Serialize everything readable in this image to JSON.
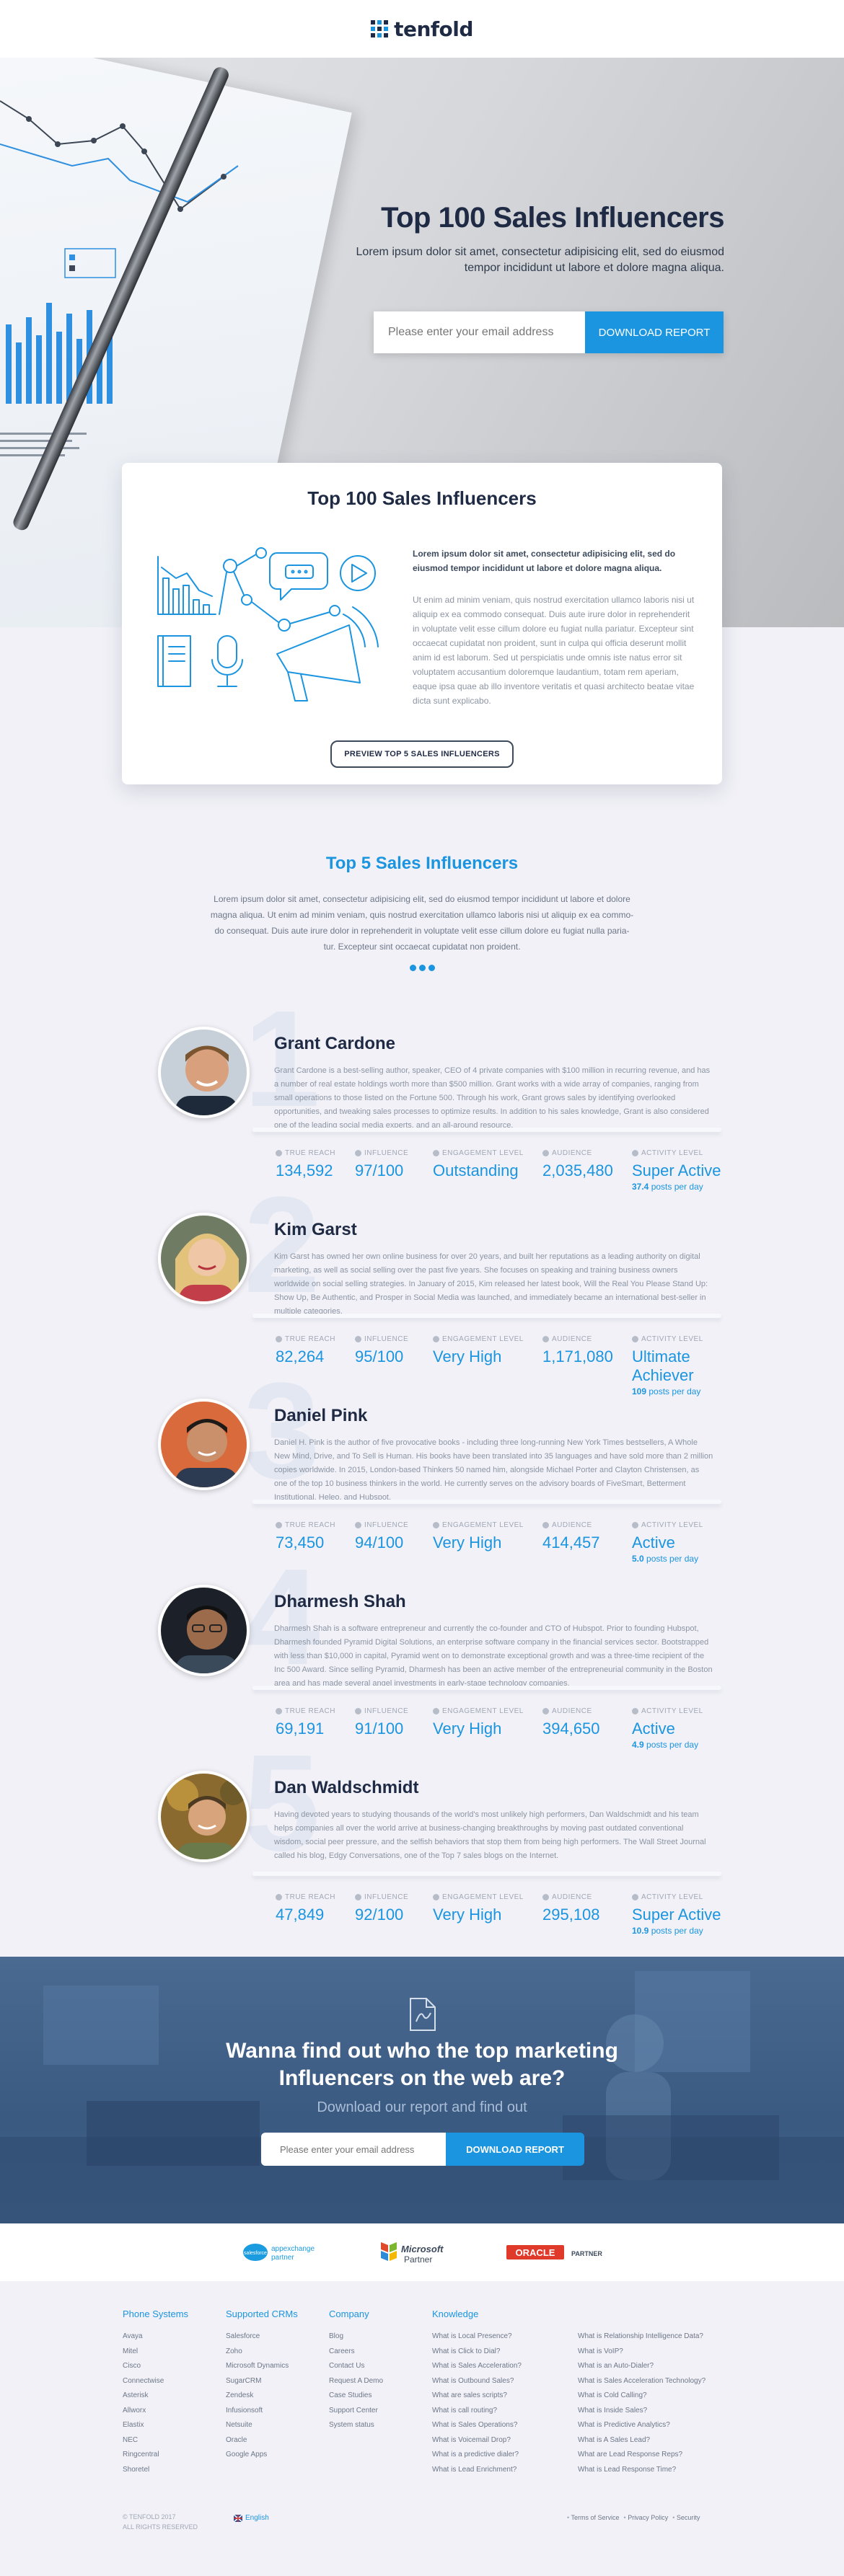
{
  "header": {
    "brand": "tenfold"
  },
  "hero": {
    "title": "Top 100 Sales Influencers",
    "subtitle": "Lorem ipsum dolor sit amet, consectetur adipisicing elit, sed do eiusmod tempor incididunt ut labore et dolore magna aliqua.",
    "email_placeholder": "Please enter your email address",
    "button": "DOWNLOAD REPORT"
  },
  "report_card": {
    "title": "Top 100 Sales Influencers",
    "lead": "Lorem ipsum dolor sit amet, consectetur adipisicing elit, sed do eiusmod tempor incididunt ut labore et dolore magna aliqua.",
    "body": "Ut enim ad minim veniam, quis nostrud exercitation ullamco laboris nisi ut aliquip ex ea commodo consequat. Duis aute irure dolor in reprehenderit in voluptate velit esse cillum dolore eu fugiat nulla pariatur. Excepteur sint occaecat cupidatat non proident, sunt in culpa qui officia deserunt mollit anim id est laborum. Sed ut perspiciatis unde omnis iste natus error sit voluptatem accusantium doloremque laudantium, totam rem aperiam, eaque ipsa quae ab illo inventore veritatis et quasi architecto beatae vitae dicta sunt explicabo.",
    "button": "PREVIEW TOP 5 SALES INFLUENCERS"
  },
  "top5": {
    "title": "Top 5 Sales Influencers",
    "intro": "Lorem ipsum dolor sit amet, consectetur adipisicing elit, sed do eiusmod tempor incididunt ut labore et dolore magna aliqua. Ut enim ad minim veniam, quis nostrud exercitation ullamco laboris nisi ut aliquip ex ea commo-do consequat. Duis aute irure dolor in reprehenderit in voluptate velit esse cillum dolore eu fugiat nulla paria-tur. Excepteur sint occaecat cupidatat non proident.",
    "labels": {
      "reach": "TRUE REACH",
      "influence": "INFLUENCE",
      "engagement": "ENGAGEMENT LEVEL",
      "audience": "AUDIENCE",
      "activity": "ACTIVITY LEVEL",
      "posts_per_day": "posts per day"
    },
    "people": [
      {
        "rank": "1",
        "name": "Grant Cardone",
        "bio": "Grant Cardone is a best-selling author, speaker, CEO of 4 private companies with $100 million in recurring revenue, and has a number of real estate holdings worth more than $500 million. Grant works with a wide array of companies, ranging from small operations to those listed on the Fortune 500. Through his work, Grant grows sales by identifying overlooked opportunities, and tweaking sales processes to optimize results. In addition to his sales knowledge, Grant is also considered one of the leading social media experts, and an all-around resource.",
        "reach": "134,592",
        "influence": "97/100",
        "engagement": "Outstanding",
        "audience": "2,035,480",
        "activity": "Super Active",
        "posts": "37.4"
      },
      {
        "rank": "2",
        "name": "Kim Garst",
        "bio": "Kim Garst has owned her own online business for over 20 years, and built her reputations as a leading authority on digital marketing, as well as social selling over the past five years. She focuses on speaking and training business owners worldwide on social selling strategies. In January of 2015, Kim released her latest book, Will the Real You Please Stand Up: Show Up, Be Authentic, and Prosper in Social Media was launched, and immediately became an international best-seller in multiple categories.",
        "reach": "82,264",
        "influence": "95/100",
        "engagement": "Very High",
        "audience": "1,171,080",
        "activity": "Ultimate Achiever",
        "posts": "109"
      },
      {
        "rank": "3",
        "name": "Daniel Pink",
        "bio": "Daniel H. Pink is the author of five provocative books - including three long-running New York Times bestsellers, A Whole New Mind, Drive, and To Sell is Human. His books have been translated into 35 languages and have sold more than 2 million copies worldwide. In 2015, London-based Thinkers 50 named him, alongside Michael Porter and Clayton Christensen, as one of the top 10 business thinkers in the world. He currently serves on the advisory boards of FiveSmart, Betterment Institutional, Heleo, and Hubspot.",
        "reach": "73,450",
        "influence": "94/100",
        "engagement": "Very High",
        "audience": "414,457",
        "activity": "Active",
        "posts": "5.0"
      },
      {
        "rank": "4",
        "name": "Dharmesh Shah",
        "bio": "Dharmesh Shah is a software entrepreneur and currently the co-founder and CTO of Hubspot. Prior to founding Hubspot, Dharmesh founded Pyramid Digital Solutions, an enterprise software company in the financial services sector. Bootstrapped with less than $10,000 in capital, Pyramid went on to demonstrate exceptional growth and was a three-time recipient of the Inc 500 Award. Since selling Pyramid, Dharmesh has been an active member of the entrepreneurial community in the Boston area and has made several angel investments in early-stage technology companies.",
        "reach": "69,191",
        "influence": "91/100",
        "engagement": "Very High",
        "audience": "394,650",
        "activity": "Active",
        "posts": "4.9"
      },
      {
        "rank": "5",
        "name": "Dan Waldschmidt",
        "bio": "Having devoted years to studying thousands of the world's most unlikely high performers, Dan Waldschmidt and his team helps companies all over the world arrive at business-changing breakthroughs by moving past outdated conventional wisdom, social peer pressure, and the selfish behaviors that stop them from being high performers. The Wall Street Journal called his blog, Edgy Conversations, one of the Top 7 sales blogs on the Internet.",
        "reach": "47,849",
        "influence": "92/100",
        "engagement": "Very High",
        "audience": "295,108",
        "activity": "Super Active",
        "posts": "10.9"
      }
    ]
  },
  "cta": {
    "title_line1": "Wanna find out who the top marketing",
    "title_line2": "Influencers on the web are?",
    "subtitle": "Download our report and find out",
    "email_placeholder": "Please enter your email address",
    "button": "DOWNLOAD REPORT"
  },
  "partners": {
    "salesforce_a": "salesforce",
    "salesforce_b": "appexchange",
    "salesforce_c": "partner",
    "microsoft_a": "Microsoft",
    "microsoft_b": "Partner",
    "oracle_a": "ORACLE",
    "oracle_b": "PARTNER"
  },
  "footer": {
    "columns": [
      {
        "title": "Phone Systems",
        "items": [
          "Avaya",
          "Mitel",
          "Cisco",
          "Connectwise",
          "Asterisk",
          "Allworx",
          "Elastix",
          "NEC",
          "Ringcentral",
          "Shoretel"
        ]
      },
      {
        "title": "Supported CRMs",
        "items": [
          "Salesforce",
          "Zoho",
          "Microsoft Dynamics",
          "SugarCRM",
          "Zendesk",
          "Infusionsoft",
          "Netsuite",
          "Oracle",
          "Google Apps"
        ]
      },
      {
        "title": "Company",
        "items": [
          "Blog",
          "Careers",
          "Contact Us",
          "Request A Demo",
          "Case Studies",
          "Support Center",
          "System status"
        ]
      },
      {
        "title": "Knowledge",
        "items": [
          "What is Local Presence?",
          "What is Click to Dial?",
          "What is Sales Acceleration?",
          "What is Outbound Sales?",
          "What are sales scripts?",
          "What is call routing?",
          "What is Sales Operations?",
          "What is Voicemail Drop?",
          "What is a predictive dialer?",
          "What is Lead Enrichment?"
        ]
      },
      {
        "title": "",
        "items": [
          "What is Relationship Intelligence Data?",
          "What is VoIP?",
          "What is an Auto-Dialer?",
          "What is Sales Acceleration Technology?",
          "What is Cold Calling?",
          "What is Inside Sales?",
          "What is Predictive Analytics?",
          "What is A Sales Lead?",
          "What are Lead Response Reps?",
          "What is Lead Response Time?"
        ]
      }
    ],
    "copyright_1": "© TENFOLD 2017",
    "copyright_2": "ALL RIGHTS RESERVED",
    "language": "English",
    "legal": [
      "Terms of Service",
      "Privacy Policy",
      "Security"
    ]
  },
  "colors": {
    "accent": "#1b95e0",
    "navy": "#1f2a44",
    "cta_bg": "#3d5d85"
  }
}
